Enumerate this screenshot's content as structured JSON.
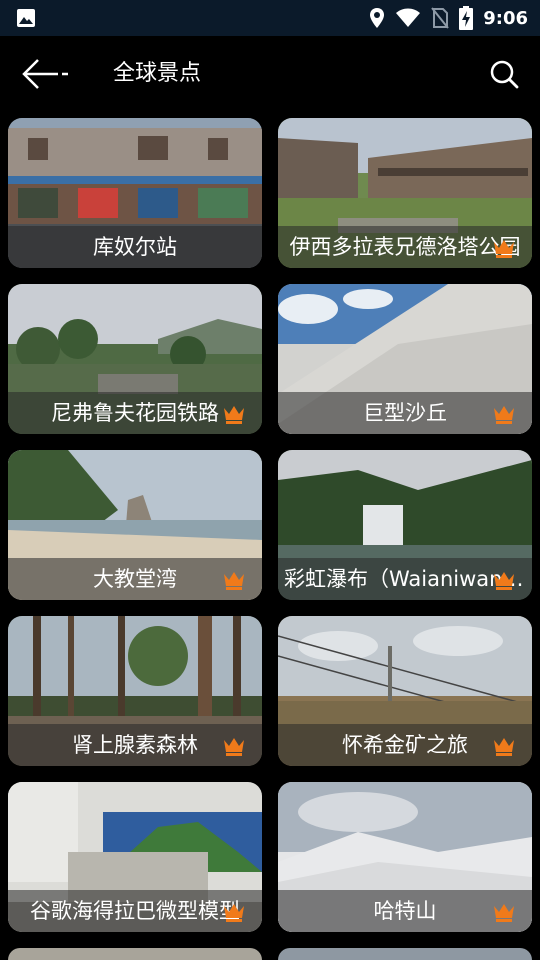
{
  "status_bar": {
    "time": "9:06",
    "icons": [
      "image-icon",
      "location-icon",
      "wifi-icon",
      "no-sim-icon",
      "battery-charging-icon"
    ]
  },
  "app_bar": {
    "title": "全球景点",
    "back_icon": "back-arrow-icon",
    "search_icon": "search-icon"
  },
  "colors": {
    "status_bg": "#0b1a2a",
    "background": "#000000",
    "crown": "#f07a1a",
    "caption_overlay": "rgba(40,40,40,0.55)"
  },
  "attractions": [
    {
      "title": "库奴尔站",
      "premium": false
    },
    {
      "title": "伊西多拉表兄德洛塔公园",
      "premium": true
    },
    {
      "title": "尼弗鲁夫花园铁路",
      "premium": true
    },
    {
      "title": "巨型沙丘",
      "premium": true
    },
    {
      "title": "大教堂湾",
      "premium": true
    },
    {
      "title": "彩虹瀑布（Waianiwaniwa）",
      "premium": true
    },
    {
      "title": "肾上腺素森林",
      "premium": true
    },
    {
      "title": "怀希金矿之旅",
      "premium": true
    },
    {
      "title": "谷歌海得拉巴微型模型",
      "premium": true
    },
    {
      "title": "哈特山",
      "premium": true
    }
  ]
}
